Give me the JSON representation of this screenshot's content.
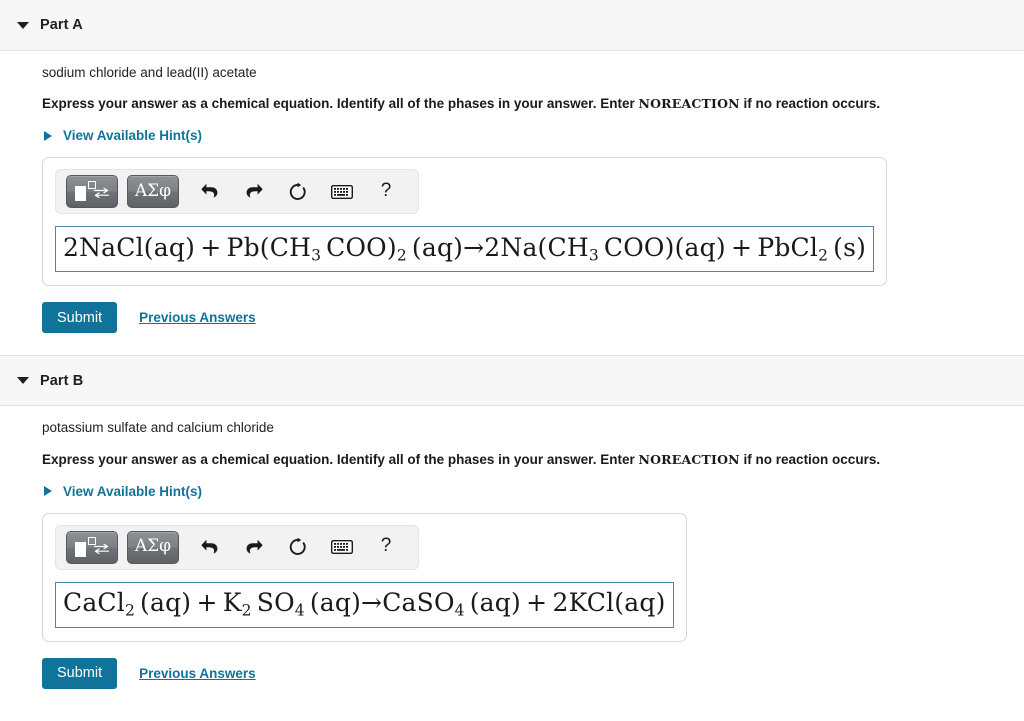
{
  "parts": [
    {
      "id": "part-a",
      "title": "Part A",
      "caret_icon": "caret-down-icon",
      "prompt": "sodium chloride and lead(II) acetate",
      "instruction_before": "Express your answer as a chemical equation. Identify all of the phases in your answer. Enter ",
      "instruction_token": "NOREACTION",
      "instruction_after": " if no reaction occurs.",
      "hints_label": "View Available Hint(s)",
      "hints_icon": "caret-right-icon",
      "toolbar": {
        "template_button_label": "",
        "template_icon": "math-template-icon",
        "greek_button_label": "ΑΣφ",
        "undo_icon": "undo-arrow-icon",
        "redo_icon": "redo-arrow-icon",
        "reset_icon": "reset-circular-arrow-icon",
        "keyboard_icon": "keyboard-icon",
        "help_label": "?"
      },
      "answer": {
        "reactant_1_coeff": "2",
        "reactant_1": "NaCl(aq)",
        "plus_1": " + ",
        "reactant_2_parts": [
          "Pb(CH",
          "3",
          " COO)",
          "2",
          " (aq)"
        ],
        "arrow": "→",
        "product_1_parts": [
          "2Na(CH",
          "3",
          " COO)(aq)"
        ],
        "plus_2": " + ",
        "product_2_parts": [
          "PbCl",
          "2",
          " (s)"
        ],
        "plain_text": "2NaCl(aq) + Pb(CH3 COO)2 (aq)→2Na(CH3 COO)(aq) + PbCl2 (s)"
      },
      "submit_label": "Submit",
      "previous_answers_label": "Previous Answers"
    },
    {
      "id": "part-b",
      "title": "Part B",
      "caret_icon": "caret-down-icon",
      "prompt": "potassium sulfate and calcium chloride",
      "instruction_before": "Express your answer as a chemical equation. Identify all of the phases in your answer. Enter ",
      "instruction_token": "NOREACTION",
      "instruction_after": " if no reaction occurs.",
      "hints_label": "View Available Hint(s)",
      "hints_icon": "caret-right-icon",
      "toolbar": {
        "template_button_label": "",
        "template_icon": "math-template-icon",
        "greek_button_label": "ΑΣφ",
        "undo_icon": "undo-arrow-icon",
        "redo_icon": "redo-arrow-icon",
        "reset_icon": "reset-circular-arrow-icon",
        "keyboard_icon": "keyboard-icon",
        "help_label": "?"
      },
      "answer": {
        "reactant_1_parts": [
          "CaCl",
          "2",
          " (aq)"
        ],
        "plus_1": " + ",
        "reactant_2_parts": [
          "K",
          "2",
          " SO",
          "4",
          " (aq)"
        ],
        "arrow": "→",
        "product_1_parts": [
          "CaSO",
          "4",
          " (aq)"
        ],
        "plus_2": " + ",
        "product_2_parts": [
          "2KCl(aq)"
        ],
        "plain_text": "CaCl2 (aq) + K2 SO4 (aq)→CaSO4 (aq) + 2KCl(aq)"
      },
      "submit_label": "Submit",
      "previous_answers_label": "Previous Answers"
    }
  ],
  "colors": {
    "accent_teal": "#10749a",
    "header_bg": "#f7f7f7",
    "input_border": "#4a8ca6",
    "toolbar_bg": "#f2f2f2"
  }
}
